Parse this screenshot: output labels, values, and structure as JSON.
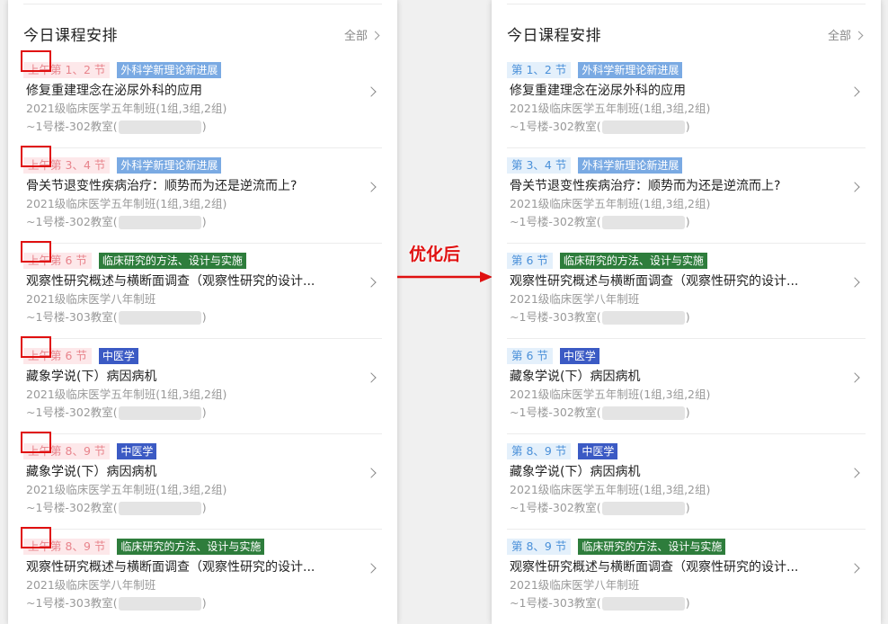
{
  "left_panel": {
    "title": "今日课程安排",
    "more": "全部",
    "courses": [
      {
        "ampm": "上午",
        "period": "第 1、2 节",
        "subject": "外科学新理论新进展",
        "subject_style": "light",
        "name": "修复重建理念在泌尿外科的应用",
        "class": "2021级临床医学五年制班(1组,3组,2组)",
        "room_prefix": "~1号楼-302教室(",
        "room_suffix": ")"
      },
      {
        "ampm": "上午",
        "period": "第 3、4 节",
        "subject": "外科学新理论新进展",
        "subject_style": "light",
        "name": "骨关节退变性疾病治疗：顺势而为还是逆流而上?",
        "class": "2021级临床医学五年制班(1组,3组,2组)",
        "room_prefix": "~1号楼-302教室(",
        "room_suffix": ")"
      },
      {
        "ampm": "上午",
        "period": "第 6 节",
        "subject": "临床研究的方法、设计与实施",
        "subject_style": "green",
        "name": "观察性研究概述与横断面调查（观察性研究的设计...",
        "class": "2021级临床医学八年制班",
        "room_prefix": "~1号楼-303教室(",
        "room_suffix": ")"
      },
      {
        "ampm": "上午",
        "period": "第 6 节",
        "subject": "中医学",
        "subject_style": "navy",
        "name": "藏象学说(下）病因病机",
        "class": "2021级临床医学五年制班(1组,3组,2组)",
        "room_prefix": "~1号楼-302教室(",
        "room_suffix": ")"
      },
      {
        "ampm": "上午",
        "period": "第 8、9 节",
        "subject": "中医学",
        "subject_style": "navy",
        "name": "藏象学说(下）病因病机",
        "class": "2021级临床医学五年制班(1组,3组,2组)",
        "room_prefix": "~1号楼-302教室(",
        "room_suffix": ")"
      },
      {
        "ampm": "上午",
        "period": "第 8、9 节",
        "subject": "临床研究的方法、设计与实施",
        "subject_style": "green",
        "name": "观察性研究概述与横断面调查（观察性研究的设计...",
        "class": "2021级临床医学八年制班",
        "room_prefix": "~1号楼-303教室(",
        "room_suffix": ")"
      }
    ]
  },
  "right_panel": {
    "title": "今日课程安排",
    "more": "全部",
    "courses": [
      {
        "period": "第 1、2 节",
        "subject": "外科学新理论新进展",
        "subject_style": "light",
        "name": "修复重建理念在泌尿外科的应用",
        "class": "2021级临床医学五年制班(1组,3组,2组)",
        "room_prefix": "~1号楼-302教室(",
        "room_suffix": ")"
      },
      {
        "period": "第 3、4 节",
        "subject": "外科学新理论新进展",
        "subject_style": "light",
        "name": "骨关节退变性疾病治疗：顺势而为还是逆流而上?",
        "class": "2021级临床医学五年制班(1组,3组,2组)",
        "room_prefix": "~1号楼-302教室(",
        "room_suffix": ")"
      },
      {
        "period": "第 6 节",
        "subject": "临床研究的方法、设计与实施",
        "subject_style": "green",
        "name": "观察性研究概述与横断面调查（观察性研究的设计...",
        "class": "2021级临床医学八年制班",
        "room_prefix": "~1号楼-303教室(",
        "room_suffix": ")"
      },
      {
        "period": "第 6 节",
        "subject": "中医学",
        "subject_style": "navy",
        "name": "藏象学说(下）病因病机",
        "class": "2021级临床医学五年制班(1组,3组,2组)",
        "room_prefix": "~1号楼-302教室(",
        "room_suffix": ")"
      },
      {
        "period": "第 8、9 节",
        "subject": "中医学",
        "subject_style": "navy",
        "name": "藏象学说(下）病因病机",
        "class": "2021级临床医学五年制班(1组,3组,2组)",
        "room_prefix": "~1号楼-302教室(",
        "room_suffix": ")"
      },
      {
        "period": "第 8、9 节",
        "subject": "临床研究的方法、设计与实施",
        "subject_style": "green",
        "name": "观察性研究概述与横断面调查（观察性研究的设计...",
        "class": "2021级临床医学八年制班",
        "room_prefix": "~1号楼-303教室(",
        "room_suffix": ")"
      }
    ]
  },
  "annotation": {
    "label": "优化后",
    "color": "#e01010"
  }
}
